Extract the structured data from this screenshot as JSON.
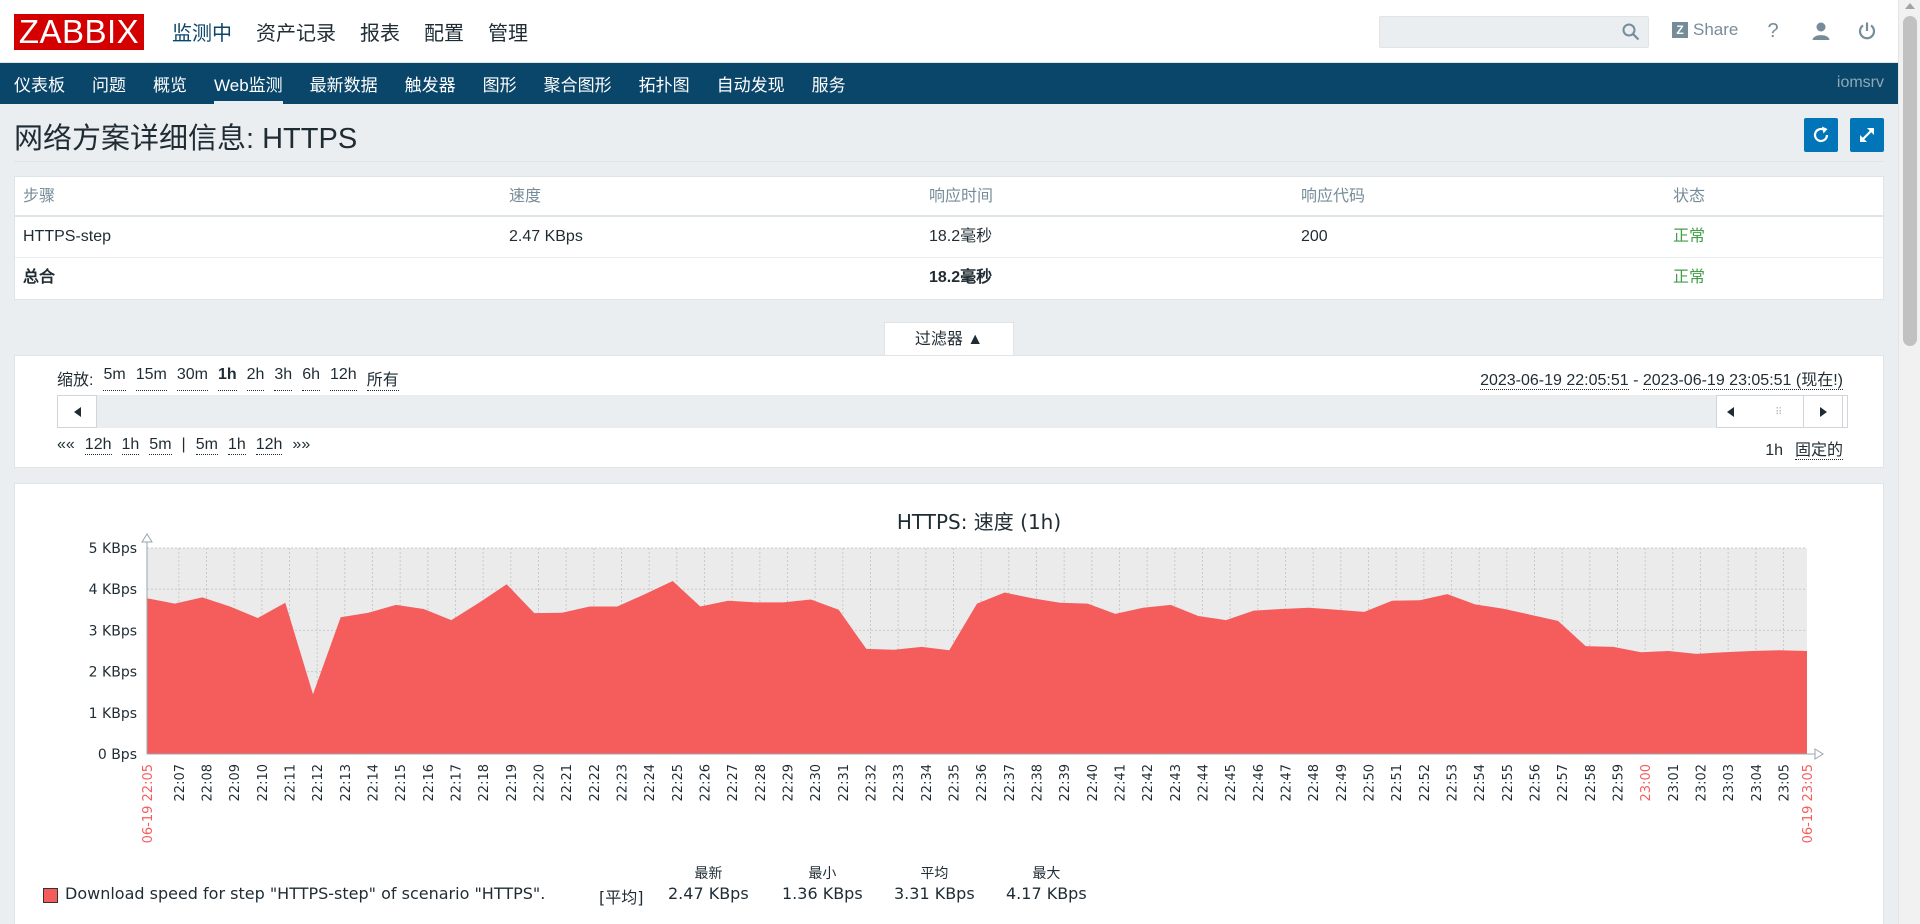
{
  "top": {
    "logo": "ZABBIX",
    "menu": [
      "监测中",
      "资产记录",
      "报表",
      "配置",
      "管理"
    ],
    "search_placeholder": "",
    "share": "Share",
    "help": "?"
  },
  "subnav": {
    "items": [
      "仪表板",
      "问题",
      "概览",
      "Web监测",
      "最新数据",
      "触发器",
      "图形",
      "聚合图形",
      "拓扑图",
      "自动发现",
      "服务"
    ],
    "active": 3,
    "user": "iomsrv"
  },
  "page": {
    "title": "网络方案详细信息: HTTPS"
  },
  "table": {
    "headers": [
      "步骤",
      "速度",
      "响应时间",
      "响应代码",
      "状态"
    ],
    "rows": [
      {
        "step": "HTTPS-step",
        "speed": "2.47 KBps",
        "time": "18.2毫秒",
        "code": "200",
        "status": "正常"
      }
    ],
    "total": {
      "label": "总合",
      "time": "18.2毫秒",
      "status": "正常"
    }
  },
  "filter": {
    "tab_label": "过滤器 ▲",
    "zoom_label": "缩放:",
    "zoom_options": [
      "5m",
      "15m",
      "30m",
      "1h",
      "2h",
      "3h",
      "6h",
      "12h",
      "所有"
    ],
    "zoom_selected": "1h",
    "range_from": "2023-06-19 22:05:51",
    "range_sep": " - ",
    "range_to": "2023-06-19 23:05:51 (现在!)",
    "shift_back": "««",
    "shift_back_options": [
      "12h",
      "1h",
      "5m"
    ],
    "shift_sep": "|",
    "shift_fwd_options": [
      "5m",
      "1h",
      "12h"
    ],
    "shift_fwd": "»»",
    "period_value": "1h",
    "period_mode": "固定的",
    "grip": "⠿"
  },
  "legend": {
    "text": "Download speed for step \"HTTPS-step\" of scenario \"HTTPS\".",
    "func": "[平均]",
    "cols": [
      {
        "header": "最新",
        "value": "2.47 KBps"
      },
      {
        "header": "最小",
        "value": "1.36 KBps"
      },
      {
        "header": "平均",
        "value": "3.31 KBps"
      },
      {
        "header": "最大",
        "value": "4.17 KBps"
      }
    ]
  },
  "colors": {
    "accent": "#0a466a",
    "logo": "#d40000",
    "ok": "#429e47",
    "series": "#f55d5d",
    "time_marker": "#f55d5d"
  },
  "chart_data": {
    "type": "area",
    "title": "HTTPS: 速度 (1h)",
    "ylabel": "",
    "xlabel": "",
    "y_ticks": [
      "0 Bps",
      "1 KBps",
      "2 KBps",
      "3 KBps",
      "4 KBps",
      "5 KBps"
    ],
    "ylim": [
      0,
      5
    ],
    "x_start_label": "06-19 22:05",
    "x_end_label": "06-19 23:05",
    "x_ticks": [
      "22:07",
      "22:08",
      "22:09",
      "22:10",
      "22:11",
      "22:12",
      "22:13",
      "22:14",
      "22:15",
      "22:16",
      "22:17",
      "22:18",
      "22:19",
      "22:20",
      "22:21",
      "22:22",
      "22:23",
      "22:24",
      "22:25",
      "22:26",
      "22:27",
      "22:28",
      "22:29",
      "22:30",
      "22:31",
      "22:32",
      "22:33",
      "22:34",
      "22:35",
      "22:36",
      "22:37",
      "22:38",
      "22:39",
      "22:40",
      "22:41",
      "22:42",
      "22:43",
      "22:44",
      "22:45",
      "22:46",
      "22:47",
      "22:48",
      "22:49",
      "22:50",
      "22:51",
      "22:52",
      "22:53",
      "22:54",
      "22:55",
      "22:56",
      "22:57",
      "22:58",
      "22:59",
      "23:00",
      "23:01",
      "23:02",
      "23:03",
      "23:04",
      "23:05"
    ],
    "highlight_ticks": [
      "23:00"
    ],
    "series": [
      {
        "name": "Download speed for step \"HTTPS-step\" of scenario \"HTTPS\".",
        "x": [
          "22:05:51",
          "22:06:51",
          "22:07:51",
          "22:08:51",
          "22:09:51",
          "22:10:51",
          "22:11:51",
          "22:12:51",
          "22:13:51",
          "22:14:51",
          "22:15:51",
          "22:16:51",
          "22:17:51",
          "22:18:51",
          "22:19:51",
          "22:20:51",
          "22:21:51",
          "22:22:51",
          "22:23:51",
          "22:24:51",
          "22:25:51",
          "22:26:51",
          "22:27:51",
          "22:28:51",
          "22:29:51",
          "22:30:51",
          "22:31:51",
          "22:32:51",
          "22:33:51",
          "22:34:51",
          "22:35:51",
          "22:36:51",
          "22:37:51",
          "22:38:51",
          "22:39:51",
          "22:40:51",
          "22:41:51",
          "22:42:51",
          "22:43:51",
          "22:44:51",
          "22:45:51",
          "22:46:51",
          "22:47:51",
          "22:48:51",
          "22:49:51",
          "22:50:51",
          "22:51:51",
          "22:52:51",
          "22:53:51",
          "22:54:51",
          "22:55:51",
          "22:56:51",
          "22:57:51",
          "22:58:51",
          "22:59:51",
          "23:00:51",
          "23:01:51",
          "23:02:51",
          "23:03:51",
          "23:04:51",
          "23:05:51"
        ],
        "values": [
          3.78,
          3.65,
          3.8,
          3.58,
          3.3,
          3.67,
          1.45,
          3.32,
          3.43,
          3.62,
          3.52,
          3.25,
          3.67,
          4.12,
          3.42,
          3.43,
          3.58,
          3.58,
          3.88,
          4.2,
          3.58,
          3.72,
          3.68,
          3.68,
          3.75,
          3.5,
          2.55,
          2.53,
          2.6,
          2.52,
          3.65,
          3.92,
          3.78,
          3.67,
          3.65,
          3.4,
          3.55,
          3.62,
          3.35,
          3.25,
          3.48,
          3.52,
          3.55,
          3.5,
          3.45,
          3.72,
          3.73,
          3.88,
          3.63,
          3.53,
          3.38,
          3.23,
          2.62,
          2.6,
          2.47,
          2.5,
          2.43,
          2.47,
          2.5,
          2.52,
          2.5
        ]
      }
    ],
    "grid": true,
    "legend_position": "bottom-left"
  }
}
